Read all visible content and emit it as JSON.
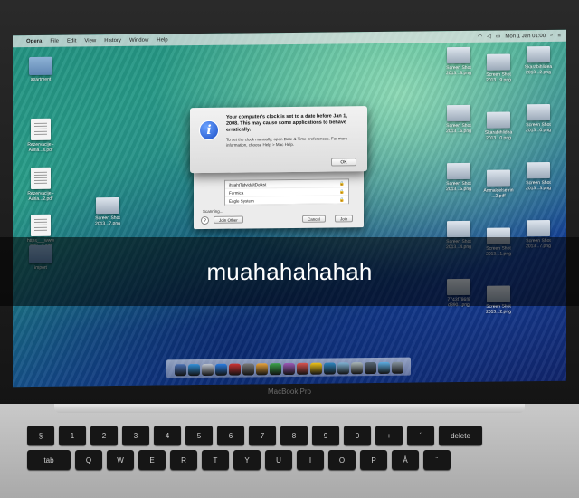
{
  "menubar": {
    "app": "Opera",
    "items": [
      "File",
      "Edit",
      "View",
      "History",
      "Window",
      "Help"
    ],
    "clock": "Mon 1 Jan 01:00"
  },
  "desktop_left": [
    {
      "label": "apartment",
      "kind": "folder"
    },
    {
      "label": "Rezervacije -\nAdria...s.pdf",
      "kind": "doc"
    },
    {
      "label": "Rezervacije -\nAdria...2.pdf",
      "kind": "doc"
    },
    {
      "label": "https___www\ndick...s.pdf",
      "kind": "doc"
    },
    {
      "label": "Screen Shot\n2013...7.png",
      "kind": "shot"
    },
    {
      "label": "import",
      "kind": "folder"
    }
  ],
  "desktop_right": [
    {
      "label": "Screen Shot\n2013...8.png"
    },
    {
      "label": "Screen Shot\n2013...9.png"
    },
    {
      "label": "Skarabihlidea\n2013...2.png"
    },
    {
      "label": "Screen Shot\n2013...6.png"
    },
    {
      "label": "Skarabihlidea\n2013...0.png"
    },
    {
      "label": "Screen Shot\n2013...0.png"
    },
    {
      "label": "Screen Shot\n2013...5.png"
    },
    {
      "label": "Anmaldelsetrin\n...2.pdf"
    },
    {
      "label": "Screen Shot\n2013...3.png"
    },
    {
      "label": "Screen Shot\n2013...4.png"
    },
    {
      "label": "Screen Shot\n2013...1.png"
    },
    {
      "label": "Screen Shot\n2013...7.png"
    },
    {
      "label": "7743f786f9\nd890...png"
    },
    {
      "label": "Screen Shot\n2013...2.png"
    }
  ],
  "alert": {
    "message": "Your computer's clock is set to a date before Jan 1, 2008. This may cause some applications to behave erratically.",
    "detail": "To set the clock manually, open Date & Time preferences. For more information, choose Help > Mac Help.",
    "ok_label": "OK"
  },
  "join_dialog": {
    "networks": [
      "ihsahtTjdvidaltDolkst",
      "Formica",
      "Eagle System"
    ],
    "scanning": "Scanning...",
    "join_other": "Join Other",
    "cancel": "Cancel",
    "join": "Join"
  },
  "caption": "muahahahahah",
  "brand": "MacBook Pro",
  "keyboard": {
    "row1": [
      "§",
      "1",
      "2",
      "3",
      "4",
      "5",
      "6",
      "7",
      "8",
      "9",
      "0",
      "+",
      "´",
      "delete"
    ],
    "row2": [
      "tab",
      "Q",
      "W",
      "E",
      "R",
      "T",
      "Y",
      "U",
      "I",
      "O",
      "P",
      "Å",
      "¨"
    ]
  },
  "dock_colors": [
    "#4a6fb0",
    "#2f8fd8",
    "#bfc6d0",
    "#2a7de1",
    "#c33",
    "#7b7b7b",
    "#e8a33a",
    "#3aa24a",
    "#9b59b6",
    "#d9534f",
    "#f0c419",
    "#2e86c1",
    "#7fb3d5",
    "#aab7b8",
    "#566573",
    "#5dade2",
    "#85929e"
  ]
}
